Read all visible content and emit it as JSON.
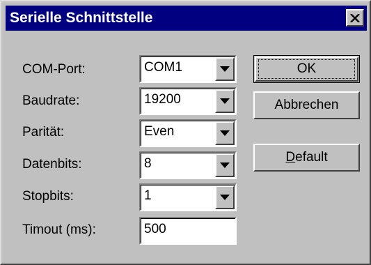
{
  "window": {
    "title": "Serielle Schnittstelle",
    "close_icon": "close-icon"
  },
  "form": {
    "com_port": {
      "label": "COM-Port:",
      "value": "COM1"
    },
    "baudrate": {
      "label": "Baudrate:",
      "value": "19200"
    },
    "paritaet": {
      "label": "Parität:",
      "value": "Even"
    },
    "datenbits": {
      "label": "Datenbits:",
      "value": "8"
    },
    "stopbits": {
      "label": "Stopbits:",
      "value": "1"
    },
    "timeout": {
      "label": "Timout (ms):",
      "value": "500"
    }
  },
  "buttons": {
    "ok": {
      "label": "OK"
    },
    "cancel": {
      "label": "Abbrechen"
    },
    "default_mnemonic": "D",
    "default_rest": "efault"
  },
  "icons": {
    "dropdown": "chevron-down-icon"
  },
  "colors": {
    "titlebar": "#000080",
    "face": "#c0c0c0"
  }
}
